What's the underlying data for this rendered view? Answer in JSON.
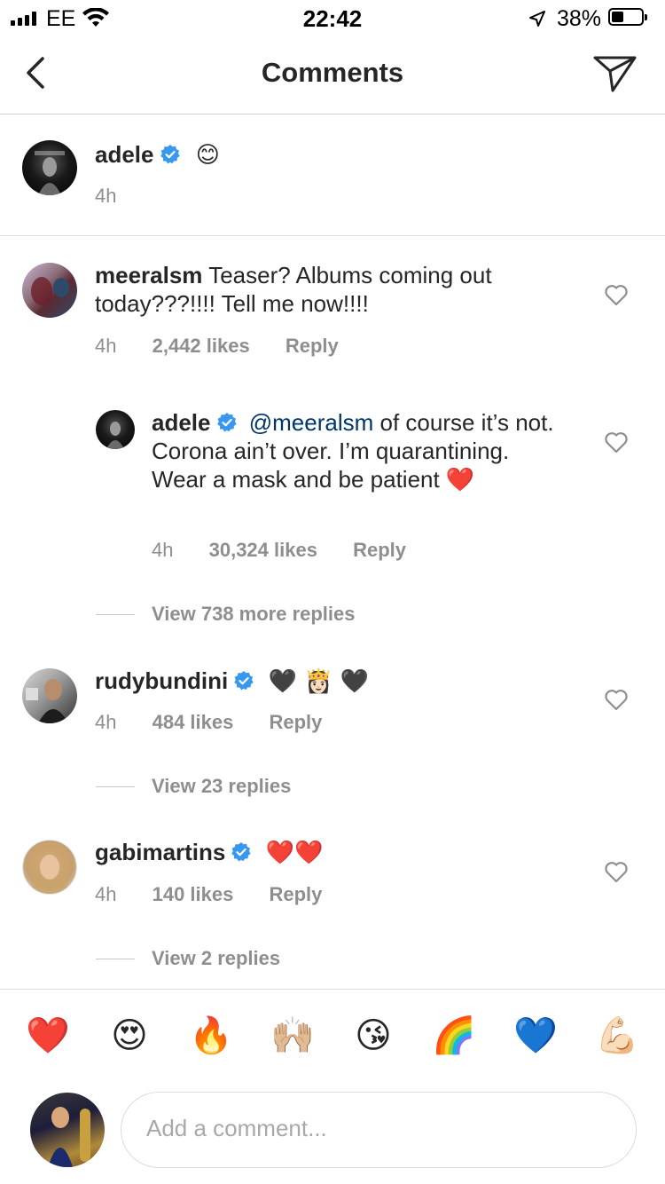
{
  "status_bar": {
    "carrier": "EE",
    "time": "22:42",
    "battery": "38%"
  },
  "header": {
    "title": "Comments"
  },
  "caption": {
    "username": "adele",
    "text": "😊",
    "time": "4h"
  },
  "comments": [
    {
      "username": "meeralsm",
      "verified": false,
      "text": "Teaser? Albums coming out today???!!!! Tell me now!!!!",
      "time": "4h",
      "likes": "2,442 likes",
      "reply": "Reply",
      "replies": [
        {
          "username": "adele",
          "verified": true,
          "mention": "@meeralsm",
          "text": "of course it’s not. Corona ain’t over. I’m quarantining. Wear a mask and be patient ❤️",
          "time": "4h",
          "likes": "30,324 likes",
          "reply": "Reply"
        }
      ],
      "view_more": "View 738 more replies"
    },
    {
      "username": "rudybundini",
      "verified": true,
      "text": "🖤 👸🏻 🖤",
      "time": "4h",
      "likes": "484 likes",
      "reply": "Reply",
      "view_more": "View 23 replies"
    },
    {
      "username": "gabimartins",
      "verified": true,
      "text": "❤️❤️",
      "time": "4h",
      "likes": "140 likes",
      "reply": "Reply",
      "view_more": "View 2 replies"
    }
  ],
  "reactions": [
    "❤️",
    "😍",
    "🔥",
    "🙌🏼",
    "😘",
    "🌈",
    "💙",
    "💪🏻"
  ],
  "composer": {
    "placeholder": "Add a comment..."
  },
  "colors": {
    "verified": "#3897f0",
    "text": "#262626",
    "muted": "#8e8e8e",
    "mention": "#003569"
  }
}
